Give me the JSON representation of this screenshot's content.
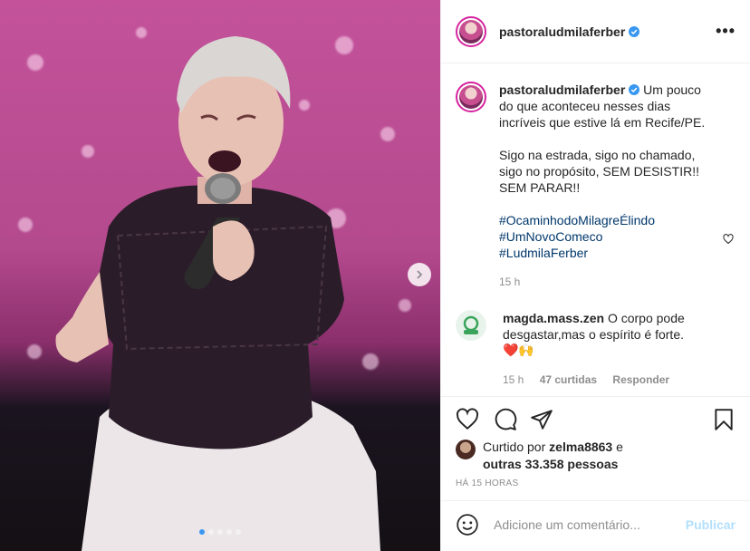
{
  "post": {
    "username": "pastoraludmilaferber",
    "more_label": "•••"
  },
  "caption": {
    "username": "pastoraludmilaferber",
    "text": "Um pouco do que aconteceu nesses dias incríveis que estive lá em Recife/PE.\n\nSigo na estrada, sigo no chamado, sigo no propósito, SEM DESISTIR!! SEM PARAR!!",
    "hashtags": [
      "#OcaminhodoMilagreÉlindo",
      "#UmNovoComeco",
      "#LudmilaFerber"
    ],
    "time": "15 h"
  },
  "comment": {
    "username": "magda.mass.zen",
    "text": "O corpo pode desgastar,mas o espírito é forte.",
    "emoji": "❤️🙌",
    "time": "15 h",
    "likes": "47 curtidas",
    "reply_label": "Responder"
  },
  "likes": {
    "prefix": "Curtido por ",
    "user": "zelma8863",
    "middle": " e",
    "others": "outras 33.358 pessoas"
  },
  "timestamp": "HÁ 15 HORAS",
  "add_comment": {
    "placeholder": "Adicione um comentário...",
    "publish_label": "Publicar"
  },
  "carousel": {
    "count": 5,
    "active_index": 0
  },
  "colors": {
    "accent": "#3897f0",
    "link": "#00376b",
    "muted": "#8e8e8e",
    "like_red": "#ed4956"
  }
}
